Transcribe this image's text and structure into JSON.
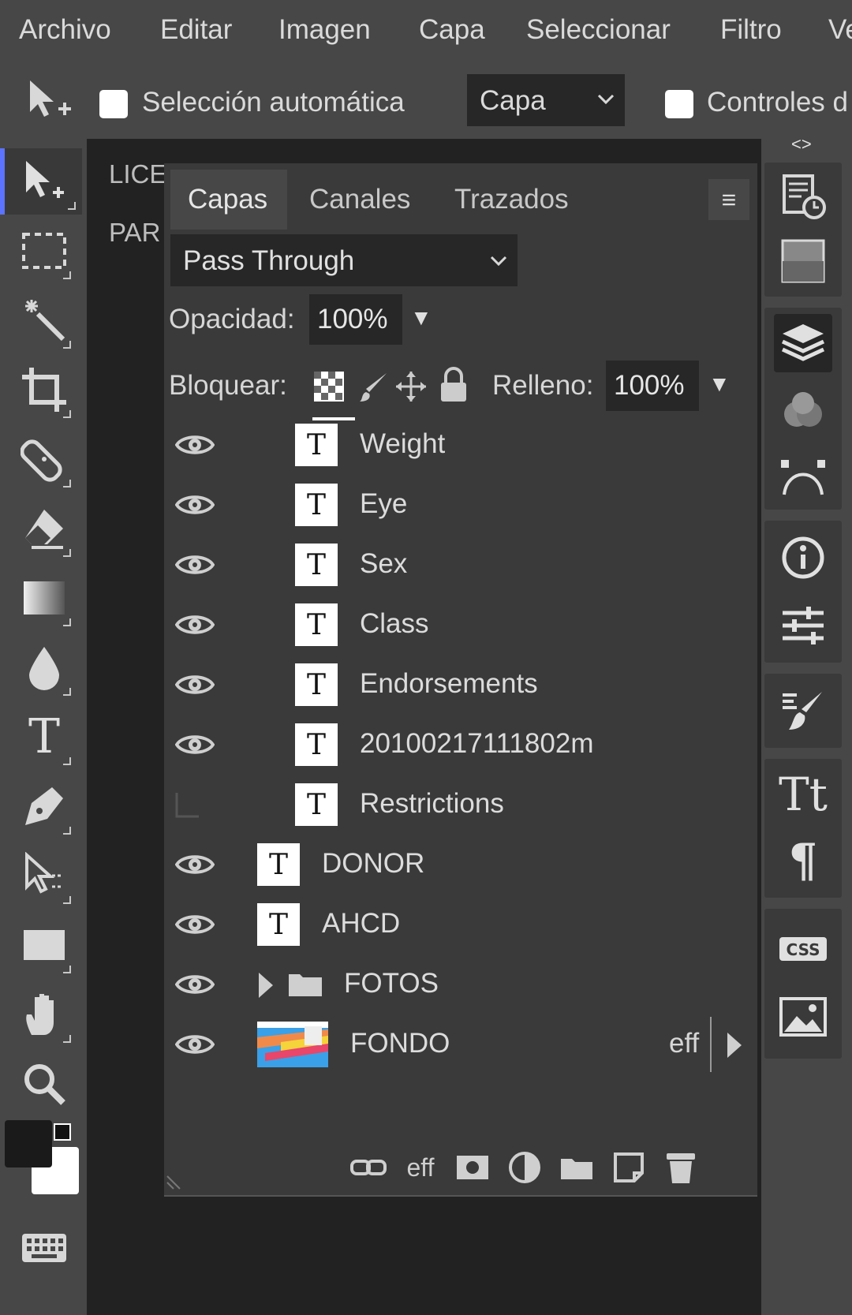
{
  "menu": {
    "items": [
      "Archivo",
      "Editar",
      "Imagen",
      "Capa",
      "Seleccionar",
      "Filtro",
      "Ve"
    ]
  },
  "options": {
    "auto_select_label": "Selección automática",
    "target_value": "Capa",
    "controls_label": "Controles d"
  },
  "document": {
    "text1": "LICE",
    "text2": "PAR"
  },
  "layers_panel": {
    "tabs": [
      "Capas",
      "Canales",
      "Trazados"
    ],
    "menu_icon": "≡",
    "blend_mode": "Pass Through",
    "opacity_label": "Opacidad:",
    "opacity_value": "100%",
    "lock_label": "Bloquear:",
    "fill_label": "Relleno:",
    "fill_value": "100%",
    "layers": [
      {
        "name": "Weight",
        "type": "text",
        "visible": true,
        "indent": 2
      },
      {
        "name": "Eye",
        "type": "text",
        "visible": true,
        "indent": 2
      },
      {
        "name": "Sex",
        "type": "text",
        "visible": true,
        "indent": 2
      },
      {
        "name": "Class",
        "type": "text",
        "visible": true,
        "indent": 2
      },
      {
        "name": "Endorsements",
        "type": "text",
        "visible": true,
        "indent": 2
      },
      {
        "name": "20100217111802m",
        "type": "text",
        "visible": true,
        "indent": 2
      },
      {
        "name": "Restrictions",
        "type": "text",
        "visible": false,
        "indent": 2
      },
      {
        "name": "DONOR",
        "type": "text",
        "visible": true,
        "indent": 1
      },
      {
        "name": "AHCD",
        "type": "text",
        "visible": true,
        "indent": 1
      },
      {
        "name": "FOTOS",
        "type": "folder",
        "visible": true,
        "indent": 1
      },
      {
        "name": "FONDO",
        "type": "image",
        "visible": true,
        "indent": 1,
        "effects": "eff"
      }
    ],
    "thumb_glyph": "T",
    "bottom_effects_label": "eff"
  },
  "right_strip": {
    "collapse_label": "<>"
  }
}
